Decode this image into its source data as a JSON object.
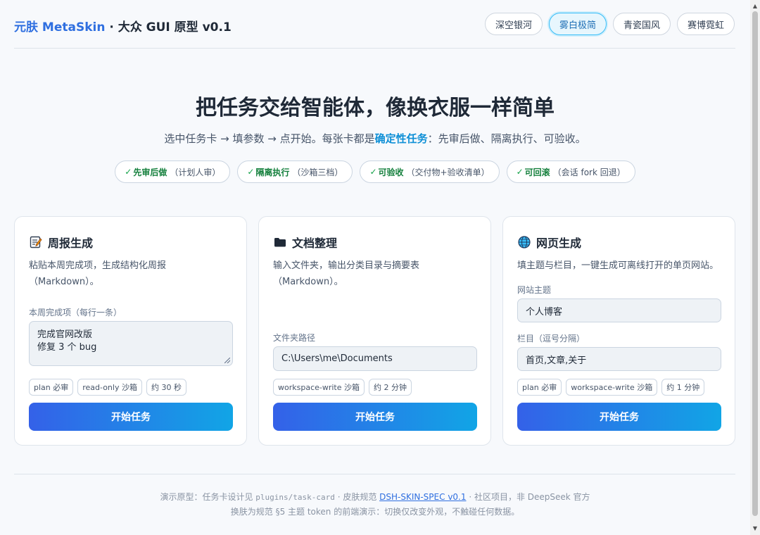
{
  "brand": {
    "accent": "元肤 MetaSkin",
    "rest": " · 大众 GUI 原型 v0.1"
  },
  "skins": [
    {
      "label": "深空银河",
      "active": false
    },
    {
      "label": "雾白极简",
      "active": true
    },
    {
      "label": "青瓷国风",
      "active": false
    },
    {
      "label": "赛博霓虹",
      "active": false
    }
  ],
  "hero": {
    "title": "把任务交给智能体，像换衣服一样简单",
    "sub_before": "选中任务卡 → 填参数 → 点开始。每张卡都是",
    "sub_highlight": "确定性任务",
    "sub_after": "：先审后做、隔离执行、可验收。"
  },
  "badges": [
    {
      "check": "✓",
      "bold": "先审后做",
      "note": "（计划人审）"
    },
    {
      "check": "✓",
      "bold": "隔离执行",
      "note": "（沙箱三档）"
    },
    {
      "check": "✓",
      "bold": "可验收",
      "note": "（交付物+验收清单）"
    },
    {
      "check": "✓",
      "bold": "可回滚",
      "note": "（会话 fork 回退）"
    }
  ],
  "cards": [
    {
      "title": "周报生成",
      "icon": "memo-icon",
      "desc": "粘贴本周完成项，生成结构化周报（Markdown）。",
      "fields": [
        {
          "label": "本周完成项（每行一条）",
          "value": "完成官网改版\n修复 3 个 bug"
        }
      ],
      "tags": [
        "plan 必审",
        "read-only 沙箱",
        "约 30 秒"
      ],
      "button": "开始任务"
    },
    {
      "title": "文档整理",
      "icon": "folder-icon",
      "desc": "输入文件夹，输出分类目录与摘要表（Markdown）。",
      "fields": [
        {
          "label": "文件夹路径",
          "value": "C:\\Users\\me\\Documents"
        }
      ],
      "tags": [
        "workspace-write 沙箱",
        "约 2 分钟"
      ],
      "button": "开始任务"
    },
    {
      "title": "网页生成",
      "icon": "globe-icon",
      "desc": "填主题与栏目，一键生成可离线打开的单页网站。",
      "fields": [
        {
          "label": "网站主题",
          "value": "个人博客"
        },
        {
          "label": "栏目（逗号分隔）",
          "value": "首页,文章,关于"
        }
      ],
      "tags": [
        "plan 必审",
        "workspace-write 沙箱",
        "约 1 分钟"
      ],
      "button": "开始任务"
    }
  ],
  "footer": {
    "line1_a": "演示原型：任务卡设计见 ",
    "line1_code": "plugins/task-card",
    "line1_b": " · 皮肤规范 ",
    "line1_link": "DSH-SKIN-SPEC v0.1",
    "line1_c": " · 社区项目，非 DeepSeek 官方",
    "line2": "换肤为规范 §5 主题 token 的前端演示：切换仅改变外观，不触碰任何数据。"
  },
  "colors": {
    "accent": "#2f6fe0",
    "highlight": "#0d8fd6",
    "check": "#16a34a",
    "button_from": "#3461e8",
    "button_to": "#11a5e6"
  }
}
